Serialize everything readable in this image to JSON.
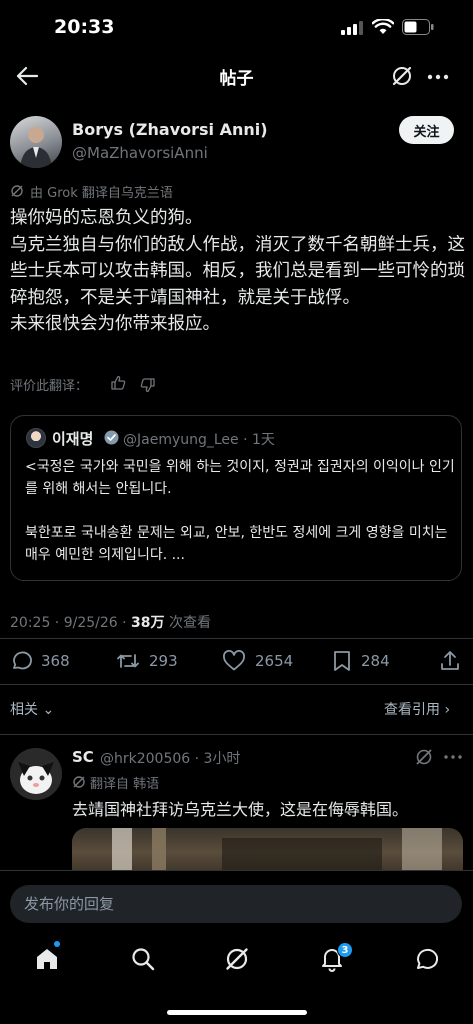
{
  "status_bar": {
    "time": "20:33"
  },
  "header": {
    "title": "帖子"
  },
  "colors": {
    "accent": "#1d9bf0",
    "background": "#000000",
    "muted": "#71767b",
    "text": "#e7e9ea"
  },
  "post": {
    "author_name": "Borys (Zhavorsi Anni)",
    "author_handle": "@MaZhavorsiAnni",
    "follow_label": "关注",
    "translated_by": "由 Grok 翻译自乌克兰语",
    "body": [
      "操你妈的忘恩负义的狗。",
      "乌克兰独自与你们的敌人作战，消灭了数千名朝鲜士兵，这些士兵本可以攻击韩国。相反，我们总是看到一些可怜的琐碎抱怨，不是关于靖国神社，就是关于战俘。",
      "未来很快会为你带来报应。"
    ],
    "rate_translation": "评价此翻译：",
    "timestamp": "20:25 · 9/25/26 · ",
    "views_count": "38万",
    "views_label": " 次查看"
  },
  "quote": {
    "name": "이재명",
    "meta": "@Jaemyung_Lee · 1天",
    "text": "<국정은 국가와 국민을 위해 하는 것이지, 정권과 집권자의 이익이나 인기를 위해 해서는 안됩니다.\n\n북한포로 국내송환 문제는 외교, 안보, 한반도 정세에 크게 영향을 미치는 매우 예민한 의제입니다. ..."
  },
  "actions": {
    "replies": "368",
    "retweets": "293",
    "likes": "2654",
    "bookmarks": "284"
  },
  "related": {
    "label": "相关 ⌄",
    "quotes_link": "查看引用 ›"
  },
  "reply": {
    "name": "SC",
    "meta": "@hrk200506 · 3小时",
    "translated": "翻译自 韩语",
    "text": "去靖国神社拜访乌克兰大使，这是在侮辱韩国。"
  },
  "compose": {
    "placeholder": "发布你的回复"
  },
  "nav": {
    "notifications_badge": "3"
  },
  "icons": [
    "back-arrow-icon",
    "grok-icon",
    "more-icon",
    "reply-icon",
    "retweet-icon",
    "like-icon",
    "bookmark-icon",
    "share-icon",
    "home-icon",
    "search-icon",
    "bell-icon",
    "message-icon",
    "verified-badge-icon",
    "thumbs-up-icon",
    "thumbs-down-icon"
  ]
}
